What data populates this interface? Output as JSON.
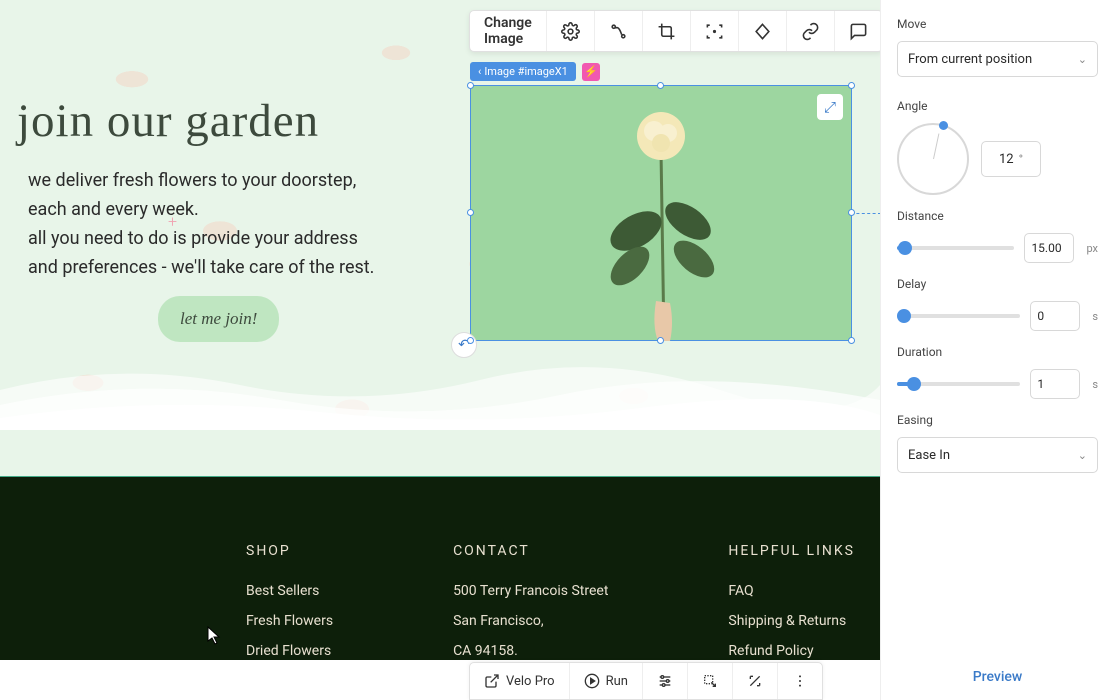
{
  "hero": {
    "headline": "join our garden",
    "line1": "we deliver fresh flowers to your doorstep,",
    "line2": "each and every week.",
    "line3": "all you need to do is provide your address",
    "line4": "and preferences - we'll take care of the rest.",
    "cta": "let me join!"
  },
  "selection": {
    "tag_label": "Image #imageX1"
  },
  "toolbar": {
    "change_image": "Change Image"
  },
  "footer": {
    "shop": {
      "title": "SHOP",
      "items": [
        "Best Sellers",
        "Fresh Flowers",
        "Dried Flowers"
      ]
    },
    "contact": {
      "title": "CONTACT",
      "line1": "500 Terry Francois Street",
      "line2": "San Francisco,",
      "line3": "CA 94158."
    },
    "helpful": {
      "title": "HELPFUL LINKS",
      "items": [
        "FAQ",
        "Shipping & Returns",
        "Refund Policy"
      ]
    }
  },
  "panel": {
    "move_label": "Move",
    "move_value": "From current position",
    "angle_label": "Angle",
    "angle_value": "12",
    "angle_unit": "°",
    "distance_label": "Distance",
    "distance_value": "15.00",
    "distance_unit": "px",
    "delay_label": "Delay",
    "delay_value": "0",
    "delay_unit": "s",
    "duration_label": "Duration",
    "duration_value": "1",
    "duration_unit": "s",
    "easing_label": "Easing",
    "easing_value": "Ease In",
    "preview": "Preview"
  },
  "bottom": {
    "velo": "Velo Pro",
    "run": "Run"
  }
}
